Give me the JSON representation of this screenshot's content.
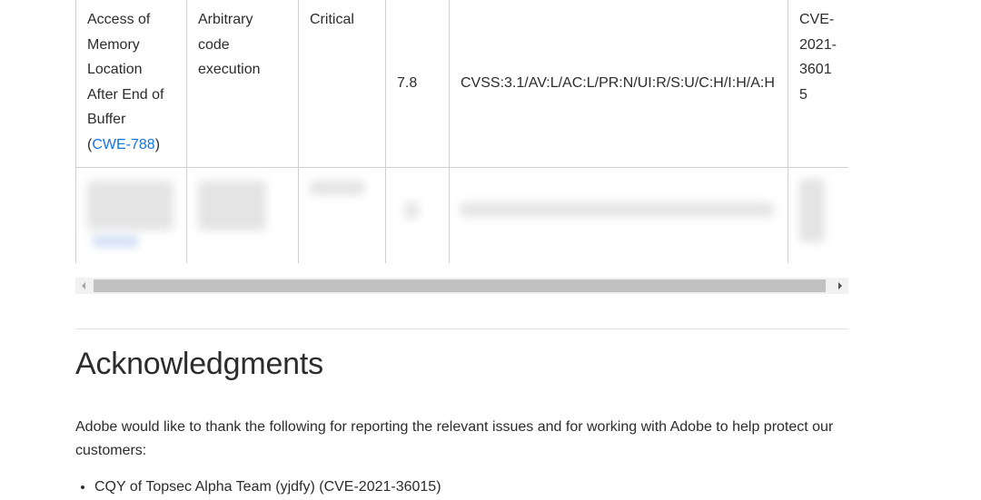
{
  "table": {
    "row1": {
      "category_lines": [
        "Access of",
        "Memory",
        "Location",
        "After End of",
        "Buffer"
      ],
      "cwe_open": "(",
      "cwe_link": "CWE-788",
      "cwe_close": ")",
      "impact": "Arbitrary code execution",
      "severity": "Critical",
      "cvss_score": "7.8",
      "cvss_vector": "CVSS:3.1/AV:L/AC:L/PR:N/UI:R/S:U/C:H/I:H/A:H",
      "cve": "CVE-2021-36015"
    }
  },
  "scrollbar": {
    "left_arrow": "left-arrow-icon",
    "right_arrow": "right-arrow-icon"
  },
  "acknowledgments": {
    "heading": "Acknowledgments",
    "intro": "Adobe would like to thank the following for reporting the relevant issues and for working with Adobe to help protect our customers:",
    "items": [
      "CQY of Topsec Alpha Team (yjdfy) (CVE-2021-36015)"
    ]
  },
  "colors": {
    "link": "#1473e6",
    "text": "#2c2c2c",
    "border": "#d0d0d0"
  }
}
